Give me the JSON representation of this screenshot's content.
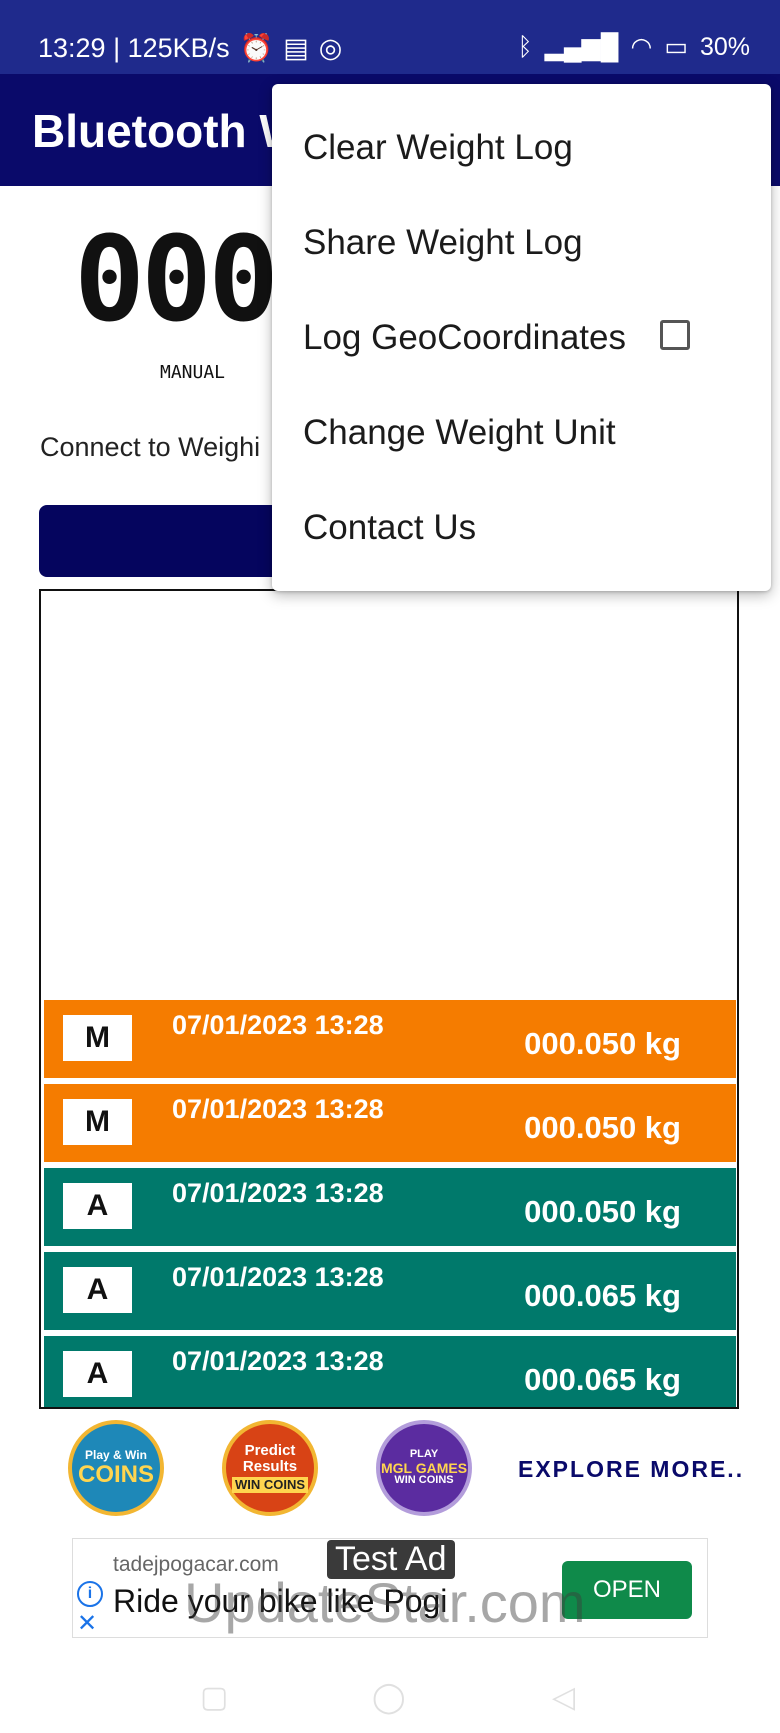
{
  "status_bar": {
    "left_text": "13:29 | 125KB/s",
    "battery": "30%",
    "icons": [
      "alarm-icon",
      "message-icon",
      "whatsapp-icon",
      "bluetooth-icon",
      "signal-icon",
      "wifi-icon",
      "battery-icon"
    ]
  },
  "app_bar": {
    "title": "Bluetooth W"
  },
  "display": {
    "digits": "000",
    "mode": "MANUAL"
  },
  "connect": {
    "label": "Connect to Weighi"
  },
  "log": [
    {
      "type": "M",
      "datetime": "07/01/2023 13:28",
      "weight": "000.050 kg",
      "color": "#f57c00"
    },
    {
      "type": "M",
      "datetime": "07/01/2023 13:28",
      "weight": "000.050 kg",
      "color": "#f57c00"
    },
    {
      "type": "A",
      "datetime": "07/01/2023 13:28",
      "weight": "000.050 kg",
      "color": "#00796b"
    },
    {
      "type": "A",
      "datetime": "07/01/2023 13:28",
      "weight": "000.065 kg",
      "color": "#00796b"
    },
    {
      "type": "A",
      "datetime": "07/01/2023 13:28",
      "weight": "000.065 kg",
      "color": "#00796b"
    }
  ],
  "promos": {
    "items": [
      {
        "line1": "Play & Win",
        "line2": "COINS"
      },
      {
        "line1": "Predict",
        "line2": "Results",
        "line3": "WIN COINS"
      },
      {
        "line1": "PLAY",
        "line2": "MGL GAMES",
        "line3": "WIN COINS"
      }
    ],
    "explore": "EXPLORE MORE.."
  },
  "ad": {
    "domain": "tadejpogacar.com",
    "headline": "Ride your bike like Pogi",
    "cta": "OPEN",
    "badge": "Test Ad"
  },
  "watermark": "UpdateStar.com",
  "menu": {
    "items": [
      {
        "label": "Clear Weight Log"
      },
      {
        "label": "Share Weight Log"
      },
      {
        "label": "Log GeoCoordinates",
        "checked": false
      },
      {
        "label": "Change Weight Unit"
      },
      {
        "label": "Contact Us"
      }
    ]
  }
}
